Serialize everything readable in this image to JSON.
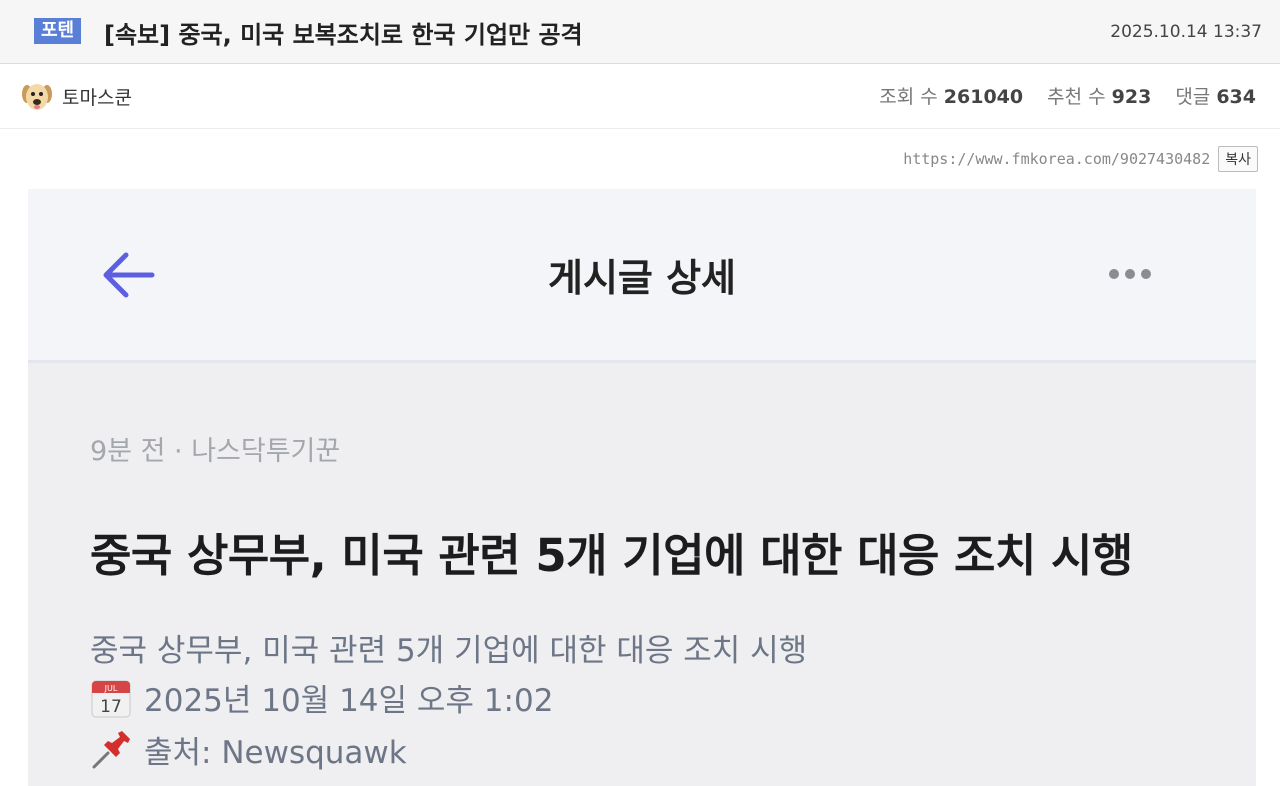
{
  "header": {
    "category_badge": "포텐",
    "title": "[속보] 중국, 미국 보복조치로 한국 기업만 공격",
    "datetime": "2025.10.14 13:37"
  },
  "author": {
    "name": "토마스쿤",
    "views_label": "조회 수",
    "views": "261040",
    "recommend_label": "추천 수",
    "recommend": "923",
    "comments_label": "댓글",
    "comments": "634"
  },
  "share": {
    "url": "https://www.fmkorea.com/9027430482",
    "copy_label": "복사"
  },
  "screenshot": {
    "app_title": "게시글 상세",
    "meta": "9분 전 · 나스닥투기꾼",
    "headline": "중국 상무부, 미국 관련 5개 기업에 대한 대응 조치 시행",
    "summary": "중국 상무부, 미국 관련 5개 기업에 대한 대응 조치 시행",
    "date_line": "2025년 10월 14일 오후 1:02",
    "calendar_month": "JUL",
    "calendar_day": "17",
    "source_line": "출처: Newsquawk"
  },
  "colors": {
    "badge": "#5a7fd6",
    "back_arrow": "#5b5fe0",
    "headline": "#1c1c1e",
    "muted": "#a4a7ad"
  },
  "icons": [
    "dog-avatar",
    "back-arrow-icon",
    "more-dots-icon",
    "calendar-icon",
    "pushpin-icon"
  ]
}
